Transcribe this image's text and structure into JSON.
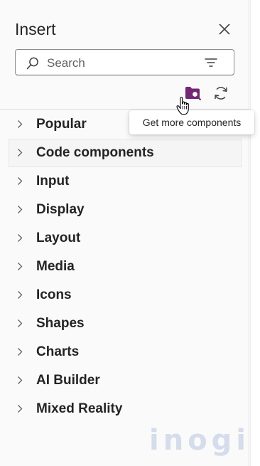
{
  "panel": {
    "title": "Insert",
    "search": {
      "placeholder": "Search",
      "value": ""
    },
    "tooltip": "Get more components",
    "icons": {
      "close": "close-icon",
      "search": "search-icon",
      "filter": "filter-icon",
      "get_more": "folder-search-icon",
      "refresh": "refresh-icon",
      "expand": "chevron-right-icon"
    },
    "accent_color": "#742774",
    "categories": [
      "Popular",
      "Code components",
      "Input",
      "Display",
      "Layout",
      "Media",
      "Icons",
      "Shapes",
      "Charts",
      "AI Builder",
      "Mixed Reality"
    ]
  },
  "watermark": {
    "text": "inogic"
  }
}
